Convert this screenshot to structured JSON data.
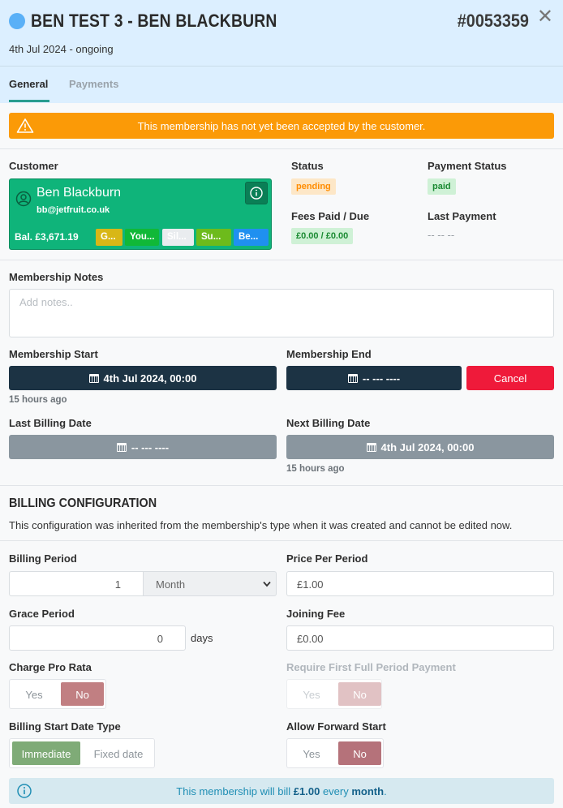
{
  "header": {
    "title": "BEN TEST 3 - BEN BLACKBURN",
    "ref": "#0053359",
    "close": "✕",
    "dates": "4th Jul 2024 - ongoing"
  },
  "tabs": [
    {
      "label": "General",
      "active": true
    },
    {
      "label": "Payments",
      "active": false
    }
  ],
  "warning": "This membership has not yet been accepted by the customer.",
  "customer": {
    "label": "Customer",
    "name": "Ben Blackburn",
    "email": "bb@jetfruit.co.uk",
    "balance": "Bal. £3,671.19",
    "chips": [
      {
        "label": "G...",
        "color": "#d8b716"
      },
      {
        "label": "You...",
        "color": "#10b838"
      },
      {
        "label": "Sil...",
        "color": "#e9ecef"
      },
      {
        "label": "Su...",
        "color": "#6dbb1c"
      },
      {
        "label": "Be...",
        "color": "#1f90f0"
      }
    ]
  },
  "status": {
    "label": "Status",
    "value": "pending",
    "color": "#ff8c00",
    "bg": "#fde7c7"
  },
  "payment_status": {
    "label": "Payment Status",
    "value": "paid",
    "color": "#1a8a32",
    "bg": "#cff1d6"
  },
  "fees": {
    "label": "Fees Paid / Due",
    "value": "£0.00 / £0.00"
  },
  "last_payment": {
    "label": "Last Payment",
    "value": "-- -- --"
  },
  "notes": {
    "label": "Membership Notes",
    "placeholder": "Add notes.."
  },
  "membership_start": {
    "label": "Membership Start",
    "value": "4th Jul 2024, 00:00",
    "ago": "15 hours ago"
  },
  "membership_end": {
    "label": "Membership End",
    "value": "-- --- ----",
    "cancel": "Cancel"
  },
  "last_billing": {
    "label": "Last Billing Date",
    "value": "-- --- ----"
  },
  "next_billing": {
    "label": "Next Billing Date",
    "value": "4th Jul 2024, 00:00",
    "ago": "15 hours ago"
  },
  "billing": {
    "title": "BILLING CONFIGURATION",
    "desc": "This configuration was inherited from the membership's type when it was created and cannot be edited now.",
    "period": {
      "label": "Billing Period",
      "value": "1",
      "unit": "Month"
    },
    "price": {
      "label": "Price Per Period",
      "value": "£1.00"
    },
    "grace": {
      "label": "Grace Period",
      "value": "0",
      "unit": "days"
    },
    "joining": {
      "label": "Joining Fee",
      "value": "£0.00"
    },
    "pro_rata": {
      "label": "Charge Pro Rata",
      "yes": "Yes",
      "no": "No",
      "selected": "No"
    },
    "first_full": {
      "label": "Require First Full Period Payment",
      "yes": "Yes",
      "no": "No",
      "selected": "No"
    },
    "start_type": {
      "label": "Billing Start Date Type",
      "a": "Immediate",
      "b": "Fixed date",
      "selected": "Immediate"
    },
    "forward": {
      "label": "Allow Forward Start",
      "yes": "Yes",
      "no": "No",
      "selected": "No"
    }
  },
  "footer": {
    "pre": "This membership will bill ",
    "amount": "£1.00",
    "mid": " every ",
    "period": "month",
    "post": "."
  }
}
